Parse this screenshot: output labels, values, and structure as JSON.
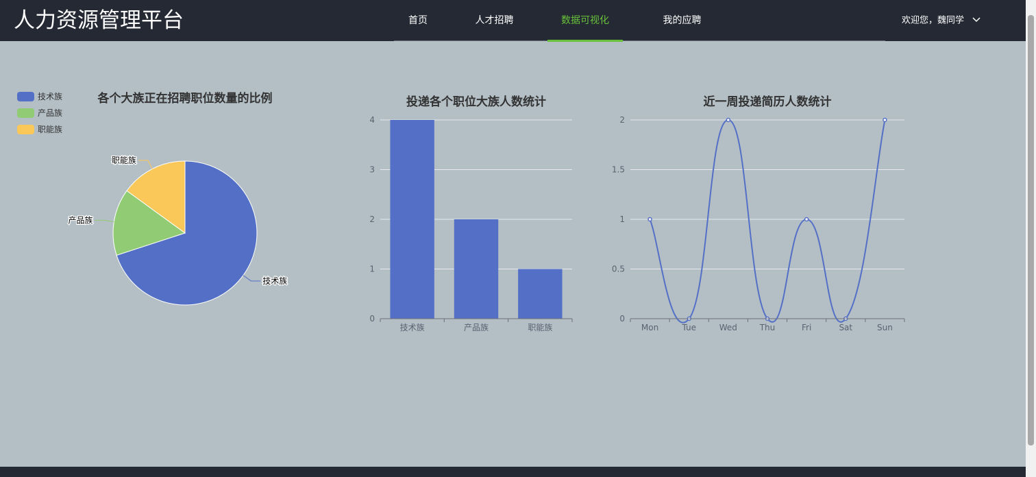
{
  "header": {
    "brand": "人力资源管理平台",
    "nav": [
      {
        "label": "首页",
        "active": false
      },
      {
        "label": "人才招聘",
        "active": false
      },
      {
        "label": "数据可视化",
        "active": true
      },
      {
        "label": "我的应聘",
        "active": false
      }
    ],
    "user_greeting": "欢迎您，魏同学"
  },
  "colors": {
    "header_bg": "#252933",
    "page_bg": "#b3bec5",
    "active_nav": "#67c23a",
    "series_blue": "#5470c6",
    "series_green": "#91cc75",
    "series_yellow": "#fac858"
  },
  "chart_data": [
    {
      "type": "pie",
      "title": "各个大族正在招聘职位数量的比例",
      "legend": [
        "技术族",
        "产品族",
        "职能族"
      ],
      "legend_position": "top-left",
      "slices": [
        {
          "name": "技术族",
          "value": 7
        },
        {
          "name": "产品族",
          "value": 1.5
        },
        {
          "name": "职能族",
          "value": 1.5
        }
      ]
    },
    {
      "type": "bar",
      "title": "投递各个职位大族人数统计",
      "categories": [
        "技术族",
        "产品族",
        "职能族"
      ],
      "values": [
        4,
        2,
        1
      ],
      "ylim": [
        0,
        4
      ],
      "yticks": [
        "0",
        "1",
        "2",
        "3",
        "4"
      ],
      "grid": true
    },
    {
      "type": "line",
      "title": "近一周投递简历人数统计",
      "categories": [
        "Mon",
        "Tue",
        "Wed",
        "Thu",
        "Fri",
        "Sat",
        "Sun"
      ],
      "values": [
        1,
        0,
        2,
        0,
        1,
        0,
        2
      ],
      "ylim": [
        0,
        2
      ],
      "yticks": [
        "0",
        "0.5",
        "1",
        "1.5",
        "2"
      ],
      "smooth": true,
      "grid": true
    }
  ]
}
